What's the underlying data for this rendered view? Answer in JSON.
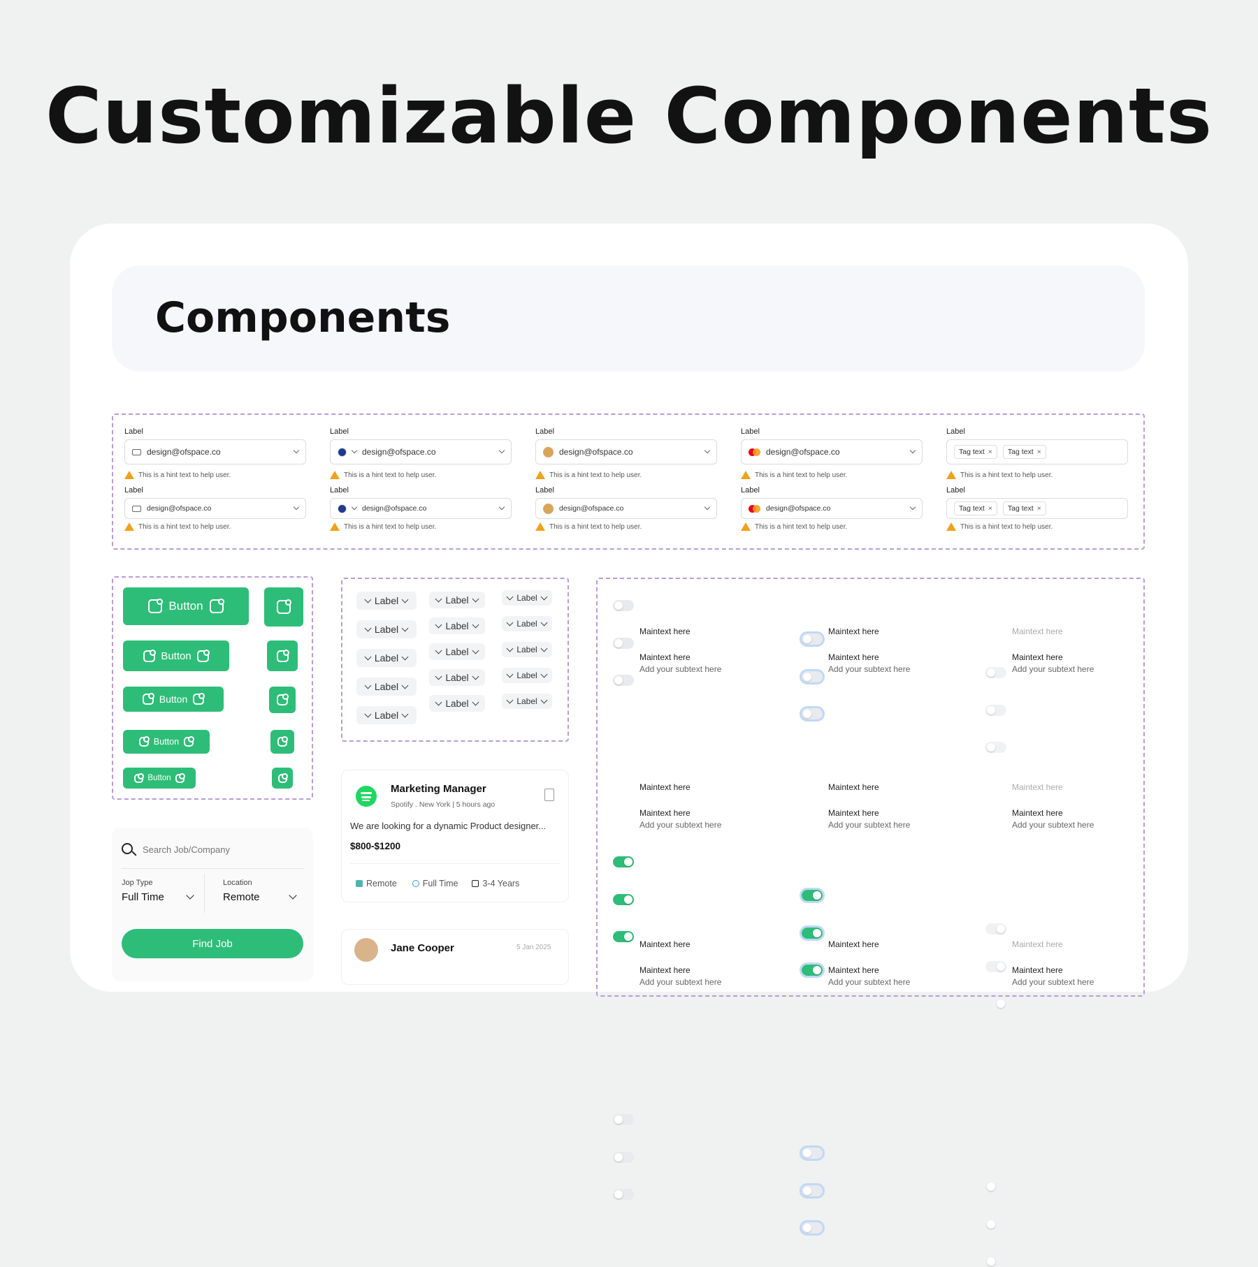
{
  "title": "Customizable Components",
  "banner_title": "Components",
  "inputs": {
    "label": "Label",
    "email": "design@ofspace.co",
    "hint": "This is a hint text to help user.",
    "tag": "Tag text",
    "tag_close": "×"
  },
  "buttons": {
    "label": "Button"
  },
  "dropdown": {
    "label": "Label"
  },
  "toggles": {
    "maintext": "Maintext here",
    "subtext": "Add your subtext here"
  },
  "search": {
    "placeholder": "Search Job/Company",
    "job_type_label": "Jop Type",
    "job_type_value": "Full Time",
    "location_label": "Location",
    "location_value": "Remote",
    "find_button": "Find Job"
  },
  "job": {
    "title": "Marketing Manager",
    "meta": "Spotify . New York | 5 hours ago",
    "description": "We are looking for a dynamic Product designer...",
    "salary": "$800-$1200",
    "tag_remote": "Remote",
    "tag_time": "Full Time",
    "tag_years": "3-4 Years"
  },
  "person": {
    "name": "Jane Cooper",
    "date": "5 Jan 2025"
  },
  "colors": {
    "accent": "#2ebd78",
    "dashed": "#b99ad8",
    "warning": "#f1a21a",
    "focus": "#bfd9f7"
  }
}
